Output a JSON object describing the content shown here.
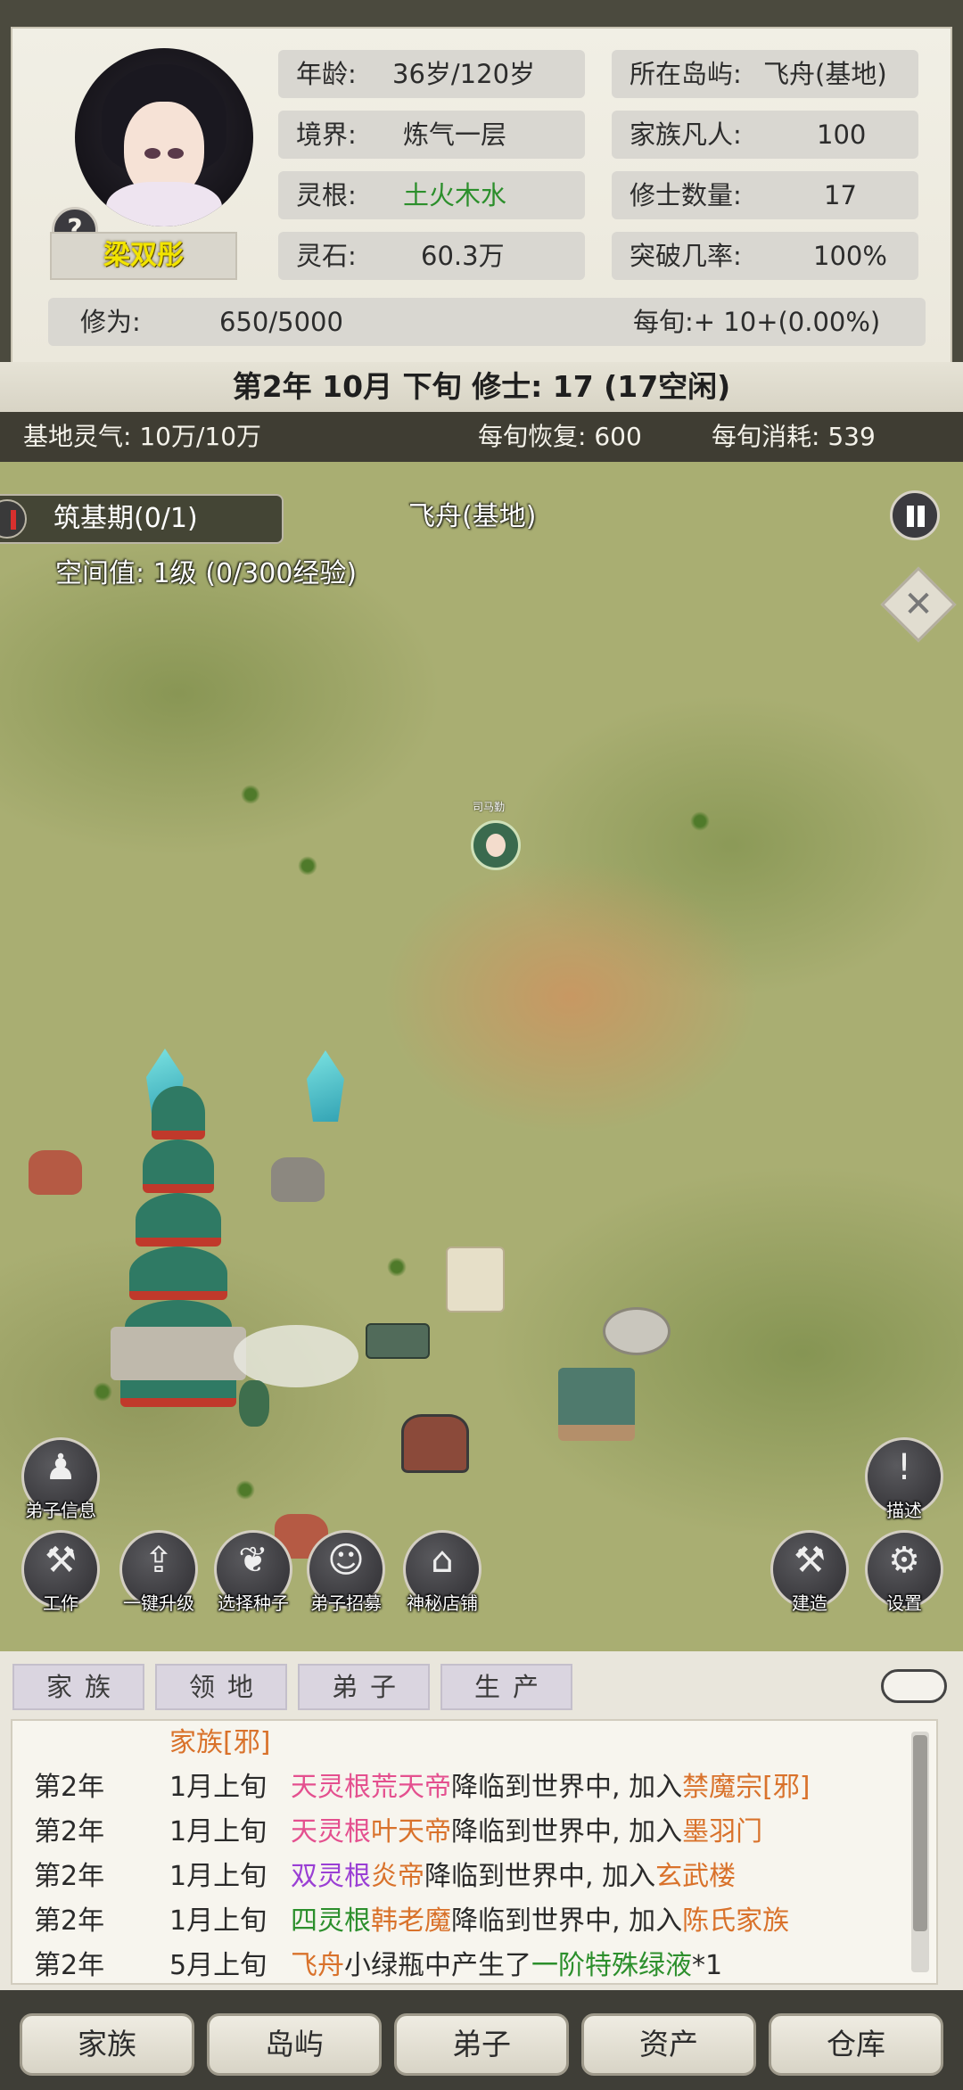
{
  "player": {
    "name": "梁双彤",
    "help_glyph": "?",
    "stats": {
      "age_label": "年龄:",
      "age_value": "36岁/120岁",
      "realm_label": "境界:",
      "realm_value": "炼气一层",
      "root_label": "灵根:",
      "root_value": "土火木水",
      "stone_label": "灵石:",
      "stone_value": "60.3万",
      "island_label": "所在岛屿:",
      "island_value": "飞舟(基地)",
      "mortals_label": "家族凡人:",
      "mortals_value": "100",
      "cultivators_label": "修士数量:",
      "cultivators_value": "17",
      "breakthrough_label": "突破几率:",
      "breakthrough_value": "100%",
      "cultivation_label": "修为:",
      "cultivation_value": "650/5000",
      "per_turn": "每旬:+ 10+(0.00%)"
    },
    "root_color": "#2c8f2c"
  },
  "date_line": "第2年 10月 下旬    修士: 17 (17空闲)",
  "resources": {
    "qi": "基地灵气: 10万/10万",
    "recover": "每旬恢复: 600",
    "consume": "每旬消耗: 539"
  },
  "map": {
    "stage_chip": "筑基期(0/1)",
    "space_value": "空间值: 1级 (0/300经验)",
    "island_name": "飞舟(基地)",
    "npc_label": "司马勤",
    "close_glyph": "✕",
    "left_buttons": [
      {
        "name": "disciple-info",
        "label": "弟子信息",
        "icon": "person-icon",
        "glyph": "♟"
      },
      {
        "name": "work",
        "label": "工作",
        "icon": "hoe-icon",
        "glyph": "⚒"
      },
      {
        "name": "one-click-upgrade",
        "label": "一键升级",
        "icon": "upgrade-icon",
        "glyph": "⇪"
      },
      {
        "name": "choose-seed",
        "label": "选择种子",
        "icon": "seed-icon",
        "glyph": "❦"
      },
      {
        "name": "disciple-recruit",
        "label": "弟子招募",
        "icon": "recruit-icon",
        "glyph": "☺"
      },
      {
        "name": "mystery-shop",
        "label": "神秘店铺",
        "icon": "shop-icon",
        "glyph": "⌂"
      }
    ],
    "right_buttons": [
      {
        "name": "describe",
        "label": "描述",
        "icon": "exclamation-icon",
        "glyph": "!"
      },
      {
        "name": "build",
        "label": "建造",
        "icon": "hammer-icon",
        "glyph": "⚒"
      },
      {
        "name": "settings",
        "label": "设置",
        "icon": "gear-icon",
        "glyph": "⚙"
      }
    ]
  },
  "tabs": [
    "家族",
    "领地",
    "弟子",
    "生产"
  ],
  "log": {
    "header": "家族[邪]",
    "rows": [
      {
        "year": "第2年",
        "time": "1月上旬",
        "parts": [
          [
            "天灵根",
            "pink"
          ],
          [
            "荒天帝",
            "pink"
          ],
          [
            "降临到世界中, 加入",
            "dark"
          ],
          [
            "禁魔宗[邪]",
            "orange"
          ]
        ]
      },
      {
        "year": "第2年",
        "time": "1月上旬",
        "parts": [
          [
            "天灵根",
            "pink"
          ],
          [
            "叶天帝",
            "orange"
          ],
          [
            "降临到世界中, 加入",
            "dark"
          ],
          [
            "墨羽门",
            "orange"
          ]
        ]
      },
      {
        "year": "第2年",
        "time": "1月上旬",
        "parts": [
          [
            "双灵根",
            "purple"
          ],
          [
            "炎帝",
            "orange"
          ],
          [
            "降临到世界中, 加入",
            "dark"
          ],
          [
            "玄武楼",
            "orange"
          ]
        ]
      },
      {
        "year": "第2年",
        "time": "1月上旬",
        "parts": [
          [
            "四灵根",
            "green"
          ],
          [
            "韩老魔",
            "orange"
          ],
          [
            "降临到世界中, 加入",
            "dark"
          ],
          [
            "陈氏家族",
            "orange"
          ]
        ]
      },
      {
        "year": "第2年",
        "time": "5月上旬",
        "parts": [
          [
            "飞舟",
            "orange"
          ],
          [
            "小绿瓶中产生了",
            "dark"
          ],
          [
            "一阶特殊绿液",
            "green"
          ],
          [
            "*1",
            "dark"
          ]
        ]
      }
    ]
  },
  "nav": [
    "家族",
    "岛屿",
    "弟子",
    "资产",
    "仓库"
  ]
}
